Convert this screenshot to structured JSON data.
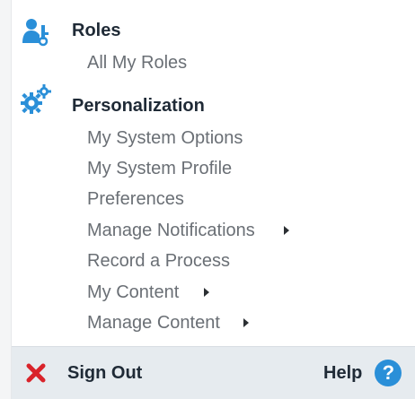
{
  "roles": {
    "title": "Roles",
    "icon": "user-key-icon",
    "items": [
      {
        "label": "All My Roles"
      }
    ]
  },
  "personalization": {
    "title": "Personalization",
    "icon": "gears-icon",
    "items": [
      {
        "label": "My System Options",
        "has_submenu": false
      },
      {
        "label": "My System Profile",
        "has_submenu": false
      },
      {
        "label": "Preferences",
        "has_submenu": false
      },
      {
        "label": "Manage Notifications",
        "has_submenu": true
      },
      {
        "label": "Record a Process",
        "has_submenu": false
      },
      {
        "label": "My Content",
        "has_submenu": true
      },
      {
        "label": "Manage Content",
        "has_submenu": true
      }
    ]
  },
  "footer": {
    "signout_label": "Sign Out",
    "signout_icon": "close-icon",
    "help_label": "Help",
    "help_icon": "help-circle-icon",
    "help_glyph": "?"
  },
  "colors": {
    "accent": "#2a8fd8",
    "signout_red": "#d9232a",
    "heading": "#1f2a36",
    "item_text": "#6a6f75",
    "footer_bg": "#e6ebef"
  }
}
